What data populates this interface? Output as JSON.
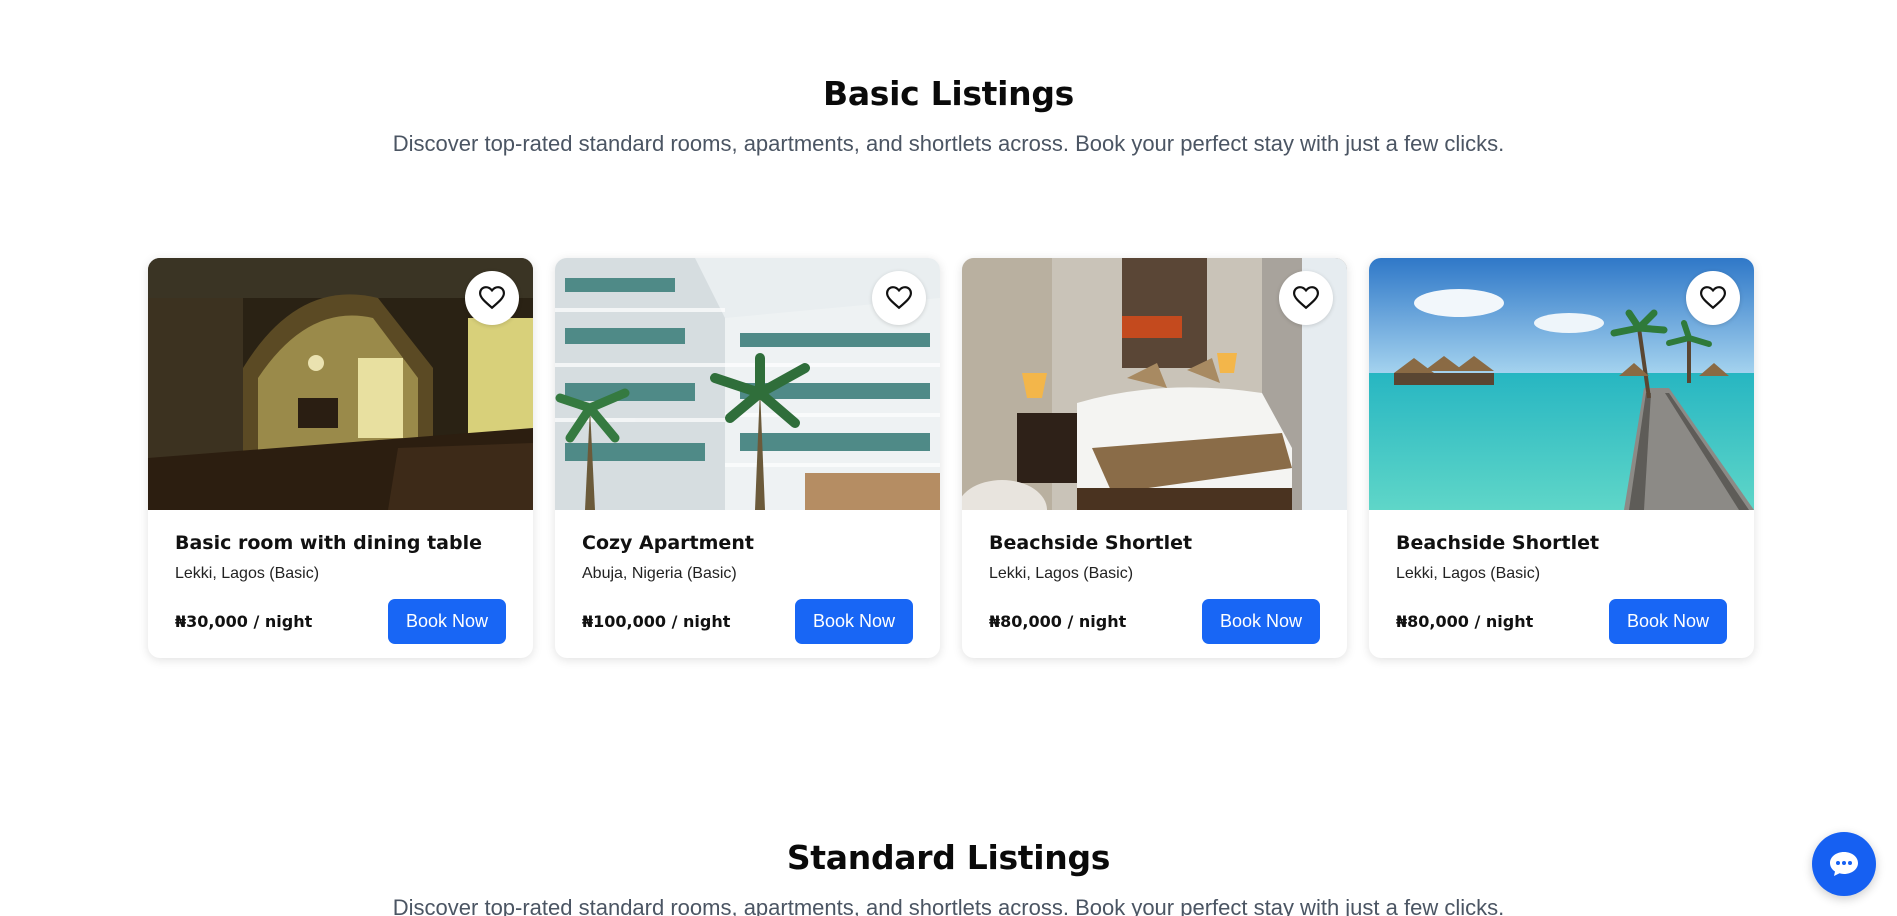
{
  "basic_section": {
    "title": "Basic Listings",
    "subtitle": "Discover top-rated standard rooms, apartments, and shortlets across. Book your perfect stay with just a few clicks."
  },
  "listings": [
    {
      "title": "Basic room with dining table",
      "location": "Lekki, Lagos (Basic)",
      "price": "₦30,000 / night",
      "button": "Book Now",
      "image": "room-with-dining-table-photo"
    },
    {
      "title": "Cozy Apartment",
      "location": "Abuja, Nigeria (Basic)",
      "price": "₦100,000 / night",
      "button": "Book Now",
      "image": "apartment-building-courtyard-photo"
    },
    {
      "title": "Beachside Shortlet",
      "location": "Lekki, Lagos (Basic)",
      "price": "₦80,000 / night",
      "button": "Book Now",
      "image": "hotel-bedroom-photo"
    },
    {
      "title": "Beachside Shortlet",
      "location": "Lekki, Lagos (Basic)",
      "price": "₦80,000 / night",
      "button": "Book Now",
      "image": "overwater-bungalows-boardwalk-photo"
    }
  ],
  "standard_section": {
    "title": "Standard Listings",
    "subtitle": "Discover top-rated standard rooms, apartments, and shortlets across. Book your perfect stay with just a few clicks."
  },
  "icons": {
    "favorite": "heart-icon",
    "chat": "chat-icon"
  },
  "colors": {
    "primary_button": "#1866f5",
    "chat_button": "#1660f2",
    "subtitle_text": "#4b5563"
  }
}
